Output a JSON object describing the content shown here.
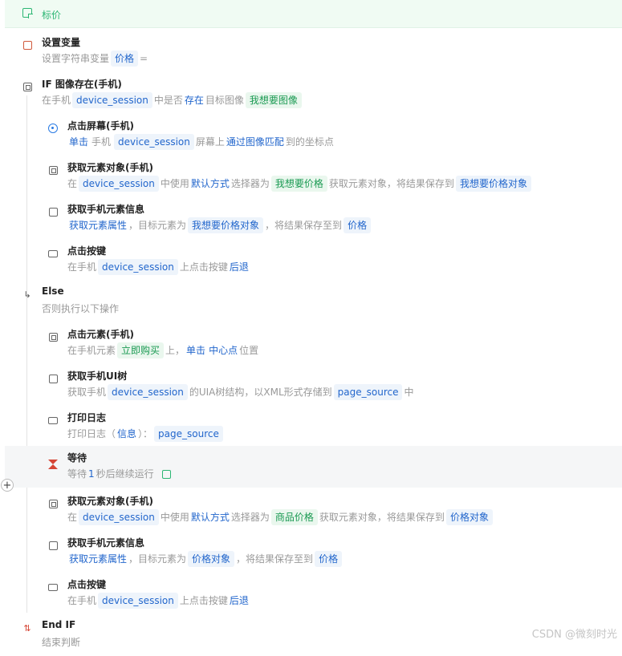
{
  "header": {
    "title": "标价"
  },
  "steps": {
    "s1": {
      "title": "设置变量",
      "t1": "设置字符串变量",
      "v1": "价格",
      "t2": "="
    },
    "s2": {
      "title": "IF 图像存在(手机)",
      "t1": "在手机",
      "v1": "device_session",
      "t2": "中是否",
      "l1": "存在",
      "t3": "目标图像",
      "g1": "我想要图像"
    },
    "s3": {
      "title": "点击屏幕(手机)",
      "l1": "单击",
      "t1": "手机",
      "v1": "device_session",
      "t2": "屏幕上",
      "l2": "通过图像匹配",
      "t3": "到的坐标点"
    },
    "s4": {
      "title": "获取元素对象(手机)",
      "t1": "在",
      "v1": "device_session",
      "t2": "中使用",
      "l1": "默认方式",
      "t3": "选择器为",
      "g1": "我想要价格",
      "t4": "获取元素对象，将结果保存到",
      "v2": "我想要价格对象"
    },
    "s5": {
      "title": "获取手机元素信息",
      "l1": "获取元素属性",
      "t1": "，目标元素为",
      "v1": "我想要价格对象",
      "t2": "，将结果保存至到",
      "v2": "价格"
    },
    "s6": {
      "title": "点击按键",
      "t1": "在手机",
      "v1": "device_session",
      "t2": "上点击按键",
      "l1": "后退"
    },
    "s7": {
      "title": "Else",
      "t1": "否则执行以下操作"
    },
    "s8": {
      "title": "点击元素(手机)",
      "t1": "在手机元素",
      "g1": "立即购买",
      "t2": "上，",
      "l1": "单击",
      "l2": "中心点",
      "t3": "位置"
    },
    "s9": {
      "title": "获取手机UI树",
      "t1": "获取手机",
      "v1": "device_session",
      "t2": "的UIA树结构，以XML形式存储到",
      "v2": "page_source",
      "t3": "中"
    },
    "s10": {
      "title": "打印日志",
      "t1": "打印日志（",
      "l1": "信息",
      "t2": "）：",
      "v1": "page_source"
    },
    "s11": {
      "title": "等待",
      "t1": "等待",
      "l1": "1",
      "t2": "秒后继续运行"
    },
    "s12": {
      "title": "获取元素对象(手机)",
      "t1": "在",
      "v1": "device_session",
      "t2": "中使用",
      "l1": "默认方式",
      "t3": "选择器为",
      "g1": "商品价格",
      "t4": "获取元素对象，将结果保存到",
      "v2": "价格对象"
    },
    "s13": {
      "title": "获取手机元素信息",
      "l1": "获取元素属性",
      "t1": "，目标元素为",
      "v1": "价格对象",
      "t2": "，将结果保存至到",
      "v2": "价格"
    },
    "s14": {
      "title": "点击按键",
      "t1": "在手机",
      "v1": "device_session",
      "t2": "上点击按键",
      "l1": "后退"
    },
    "s15": {
      "title": "End IF",
      "t1": "结束判断"
    }
  },
  "add_button": "+",
  "watermark": "CSDN @微刻时光",
  "colors": {
    "accent_green": "#2bb673",
    "link_blue": "#2266cc",
    "tag_blue_bg": "#eef4fb",
    "tag_green_bg": "#eaf7ee"
  },
  "icons": [
    "note-icon",
    "variable-icon",
    "image-exists-icon",
    "tap-screen-icon",
    "element-object-icon",
    "element-info-icon",
    "key-press-icon",
    "branch-icon",
    "click-element-icon",
    "ui-tree-icon",
    "print-log-icon",
    "hourglass-icon",
    "edit-check-icon",
    "end-if-icon"
  ]
}
